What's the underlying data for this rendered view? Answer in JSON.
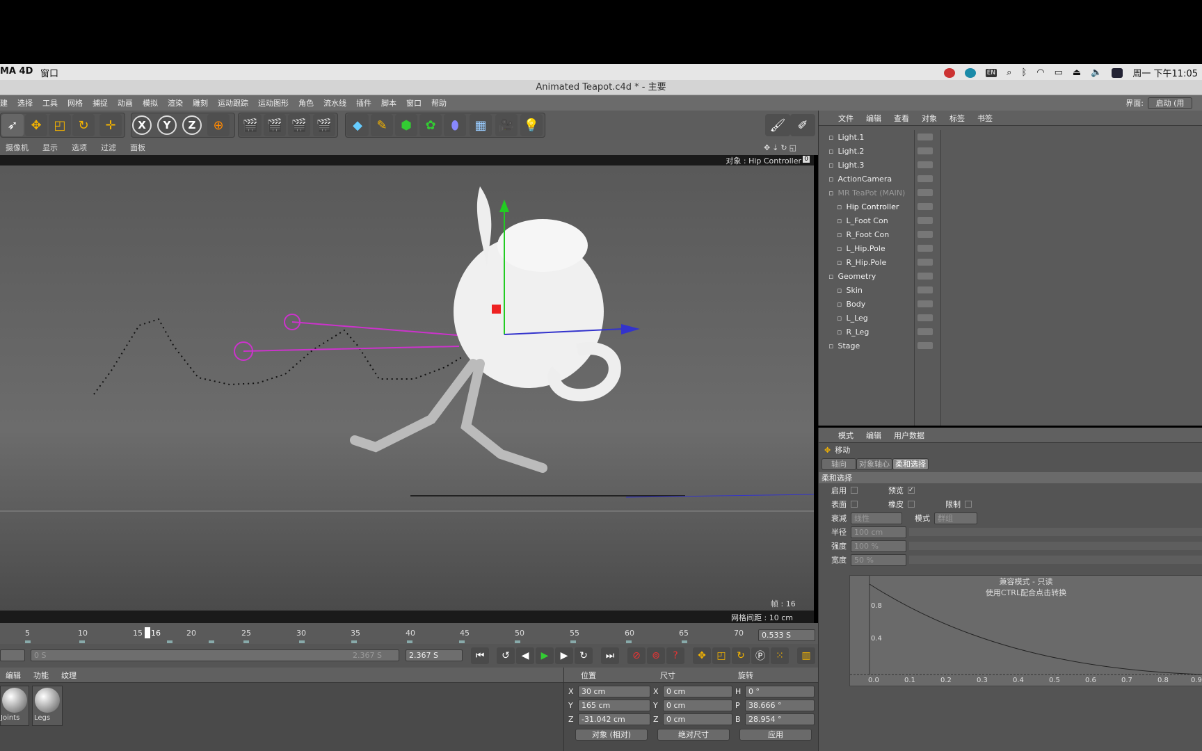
{
  "mac": {
    "app": "MA 4D",
    "window": "窗口",
    "en": "EN",
    "clock": "周一 下午11:05"
  },
  "title": "Animated Teapot.c4d * - 主要",
  "menu": [
    "建",
    "选择",
    "工具",
    "网格",
    "捕捉",
    "动画",
    "模拟",
    "渲染",
    "雕刻",
    "运动跟踪",
    "运动图形",
    "角色",
    "流水线",
    "插件",
    "脚本",
    "窗口",
    "帮助"
  ],
  "interface_label": "界面:",
  "interface_value": "启动 (用",
  "toolbar": {
    "x": "X",
    "y": "Y",
    "z": "Z"
  },
  "viewport_menu": [
    "摄像机",
    "显示",
    "选项",
    "过滤",
    "面板"
  ],
  "viewport": {
    "object_label": "对象 : Hip Controller",
    "object_icon": "0",
    "frame_label": "帧 : 16",
    "grid_label": "网格间距 : 10 cm"
  },
  "timeline": {
    "ticks": [
      "5",
      "10",
      "15",
      "16",
      "20",
      "25",
      "30",
      "35",
      "40",
      "45",
      "50",
      "55",
      "60",
      "65",
      "70"
    ],
    "time_right": "0.533 S",
    "range_start": "0 S",
    "range_end": "2.367 S",
    "current_time": "2.367 S"
  },
  "materials": {
    "menu": [
      "编辑",
      "功能",
      "纹理"
    ],
    "items": [
      "Joints",
      "Legs"
    ]
  },
  "coords": {
    "headers": [
      "位置",
      "尺寸",
      "旋转"
    ],
    "rows": [
      {
        "axis": "X",
        "pos": "30 cm",
        "saxis": "X",
        "size": "0 cm",
        "raxis": "H",
        "rot": "0 °"
      },
      {
        "axis": "Y",
        "pos": "165 cm",
        "saxis": "Y",
        "size": "0 cm",
        "raxis": "P",
        "rot": "38.666 °"
      },
      {
        "axis": "Z",
        "pos": "-31.042 cm",
        "saxis": "Z",
        "size": "0 cm",
        "raxis": "B",
        "rot": "28.954 °"
      }
    ],
    "mode1": "对象 (相对)",
    "mode2": "绝对尺寸",
    "apply": "应用"
  },
  "objmgr": {
    "menu": [
      "文件",
      "编辑",
      "查看",
      "对象",
      "标签",
      "书签"
    ],
    "objects": [
      {
        "name": "Light.1",
        "indent": 0
      },
      {
        "name": "Light.2",
        "indent": 0
      },
      {
        "name": "Light.3",
        "indent": 0
      },
      {
        "name": "ActionCamera",
        "indent": 0
      },
      {
        "name": "MR TeaPot (MAIN)",
        "indent": 0
      },
      {
        "name": "Hip Controller",
        "indent": 1
      },
      {
        "name": "L_Foot Con",
        "indent": 1
      },
      {
        "name": "R_Foot Con",
        "indent": 1
      },
      {
        "name": "L_Hip.Pole",
        "indent": 1
      },
      {
        "name": "R_Hip.Pole",
        "indent": 1
      },
      {
        "name": "Geometry",
        "indent": 0
      },
      {
        "name": "Skin",
        "indent": 1
      },
      {
        "name": "Body",
        "indent": 1
      },
      {
        "name": "L_Leg",
        "indent": 1
      },
      {
        "name": "R_Leg",
        "indent": 1
      },
      {
        "name": "Stage",
        "indent": 0
      }
    ]
  },
  "attr": {
    "menu": [
      "模式",
      "编辑",
      "用户数据"
    ],
    "tool": "移动",
    "tabs": [
      "轴向",
      "对象轴心",
      "柔和选择"
    ],
    "section": "柔和选择",
    "enable": "启用",
    "preview": "预览",
    "surface": "表面",
    "rubber": "橡皮",
    "restrict": "限制",
    "falloff_label": "衰减",
    "falloff_value": "线性",
    "mode_label": "模式",
    "mode_value": "群组",
    "radius_label": "半径",
    "radius_value": "100 cm",
    "strength_label": "强度",
    "strength_value": "100 %",
    "width_label": "宽度",
    "width_value": "50 %",
    "graph_title": "兼容模式 - 只读",
    "graph_hint": "使用CTRL配合点击转换",
    "graph_y": [
      "0.8",
      "0.4"
    ],
    "graph_x": [
      "0.0",
      "0.1",
      "0.2",
      "0.3",
      "0.4",
      "0.5",
      "0.6",
      "0.7",
      "0.8",
      "0.9"
    ]
  }
}
